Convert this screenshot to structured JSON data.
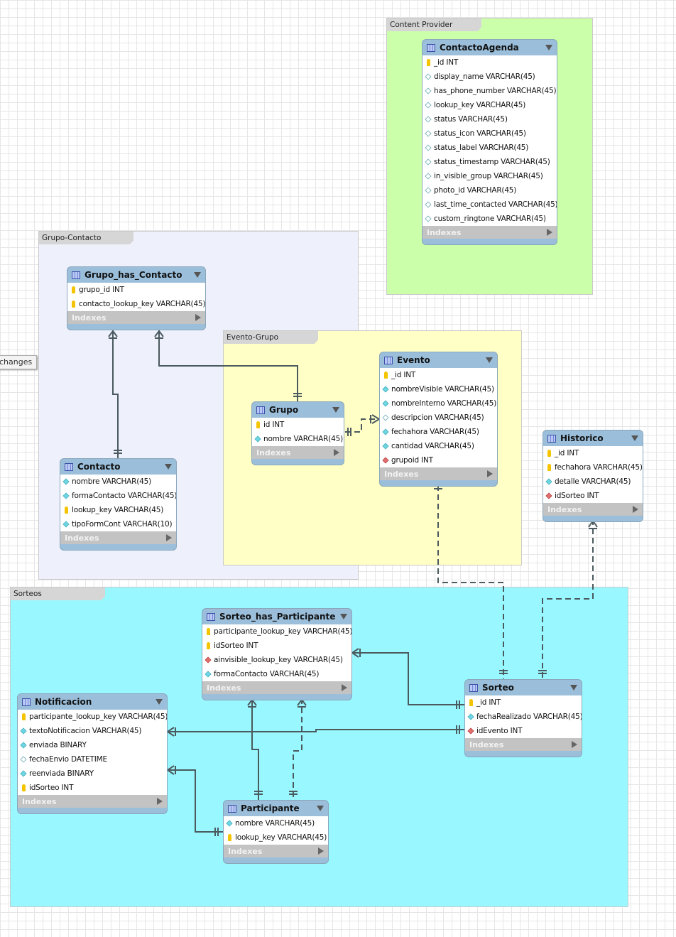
{
  "changes_button": "changes",
  "layers": {
    "content_provider": "Content Provider",
    "grupo_contacto": "Grupo-Contacto",
    "evento_grupo": "Evento-Grupo",
    "sorteos": "Sorteos"
  },
  "indexes_label": "Indexes",
  "colors": {
    "content_provider": "#ccffaa",
    "grupo_contacto": "#eef0fc",
    "evento_grupo": "#ffffc6",
    "sorteos": "#99f8ff",
    "table_header": "#9bbfdb"
  },
  "tables": {
    "contacto_agenda": {
      "title": "ContactoAgenda",
      "columns": [
        {
          "text": "_id INT",
          "icon": "pk"
        },
        {
          "text": "display_name VARCHAR(45)",
          "icon": "nn"
        },
        {
          "text": "has_phone_number VARCHAR(45)",
          "icon": "nn"
        },
        {
          "text": "lookup_key VARCHAR(45)",
          "icon": "nn"
        },
        {
          "text": "status VARCHAR(45)",
          "icon": "nn"
        },
        {
          "text": "status_icon VARCHAR(45)",
          "icon": "nn"
        },
        {
          "text": "status_label VARCHAR(45)",
          "icon": "nn"
        },
        {
          "text": "status_timestamp VARCHAR(45)",
          "icon": "nn"
        },
        {
          "text": "in_visible_group VARCHAR(45)",
          "icon": "nn"
        },
        {
          "text": "photo_id VARCHAR(45)",
          "icon": "nn"
        },
        {
          "text": "last_time_contacted VARCHAR(45)",
          "icon": "nn"
        },
        {
          "text": "custom_ringtone VARCHAR(45)",
          "icon": "nn"
        }
      ]
    },
    "grupo_has_contacto": {
      "title": "Grupo_has_Contacto",
      "columns": [
        {
          "text": "grupo_id INT",
          "icon": "pk"
        },
        {
          "text": "contacto_lookup_key VARCHAR(45)",
          "icon": "pk"
        }
      ]
    },
    "grupo": {
      "title": "Grupo",
      "columns": [
        {
          "text": "id INT",
          "icon": "pk"
        },
        {
          "text": "nombre VARCHAR(45)",
          "icon": "col"
        }
      ]
    },
    "evento": {
      "title": "Evento",
      "columns": [
        {
          "text": "_id INT",
          "icon": "pk"
        },
        {
          "text": "nombreVisible VARCHAR(45)",
          "icon": "col"
        },
        {
          "text": "nombreInterno VARCHAR(45)",
          "icon": "col"
        },
        {
          "text": "descripcion VARCHAR(45)",
          "icon": "nn"
        },
        {
          "text": "fechahora VARCHAR(45)",
          "icon": "col"
        },
        {
          "text": "cantidad VARCHAR(45)",
          "icon": "col"
        },
        {
          "text": "grupoid INT",
          "icon": "fk"
        }
      ]
    },
    "contacto": {
      "title": "Contacto",
      "columns": [
        {
          "text": "nombre VARCHAR(45)",
          "icon": "col"
        },
        {
          "text": "formaContacto VARCHAR(45)",
          "icon": "col"
        },
        {
          "text": "lookup_key VARCHAR(45)",
          "icon": "pk"
        },
        {
          "text": "tipoFormCont VARCHAR(10)",
          "icon": "col"
        }
      ]
    },
    "historico": {
      "title": "Historico",
      "columns": [
        {
          "text": "_id INT",
          "icon": "pk"
        },
        {
          "text": "fechahora VARCHAR(45)",
          "icon": "pk"
        },
        {
          "text": "detalle VARCHAR(45)",
          "icon": "col"
        },
        {
          "text": "idSorteo INT",
          "icon": "fk"
        }
      ]
    },
    "sorteo_has_participante": {
      "title": "Sorteo_has_Participante",
      "columns": [
        {
          "text": "participante_lookup_key VARCHAR(45)",
          "icon": "pk"
        },
        {
          "text": "idSorteo INT",
          "icon": "pk"
        },
        {
          "text": "ainvisible_lookup_key VARCHAR(45)",
          "icon": "fk"
        },
        {
          "text": "formaContacto VARCHAR(45)",
          "icon": "col"
        }
      ]
    },
    "notificacion": {
      "title": "Notificacion",
      "columns": [
        {
          "text": "participante_lookup_key VARCHAR(45)",
          "icon": "pk"
        },
        {
          "text": "textoNotificacion VARCHAR(45)",
          "icon": "col"
        },
        {
          "text": "enviada BINARY",
          "icon": "col"
        },
        {
          "text": "fechaEnvio DATETIME",
          "icon": "nn"
        },
        {
          "text": "reenviada BINARY",
          "icon": "col"
        },
        {
          "text": "idSorteo INT",
          "icon": "pk"
        }
      ]
    },
    "sorteo": {
      "title": "Sorteo",
      "columns": [
        {
          "text": "_id INT",
          "icon": "pk"
        },
        {
          "text": "fechaRealizado VARCHAR(45)",
          "icon": "col"
        },
        {
          "text": "idEvento INT",
          "icon": "fk"
        }
      ]
    },
    "participante": {
      "title": "Participante",
      "columns": [
        {
          "text": "nombre VARCHAR(45)",
          "icon": "col"
        },
        {
          "text": "lookup_key VARCHAR(45)",
          "icon": "pk"
        }
      ]
    }
  }
}
